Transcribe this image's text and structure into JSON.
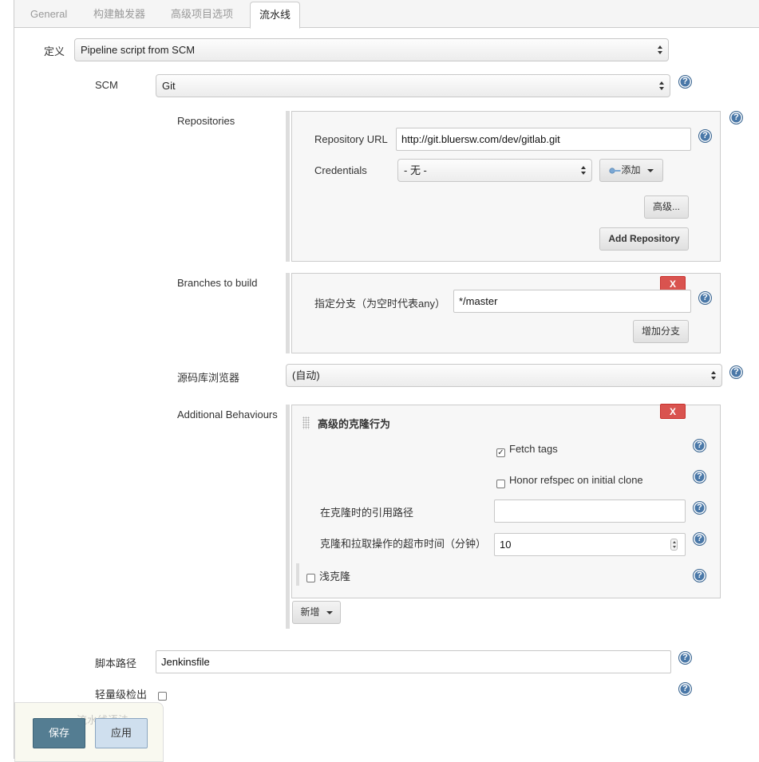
{
  "tabs": [
    "General",
    "构建触发器",
    "高级项目选项",
    "流水线"
  ],
  "definition": {
    "label": "定义",
    "value": "Pipeline script from SCM"
  },
  "scm": {
    "label": "SCM",
    "value": "Git"
  },
  "repositories": {
    "label": "Repositories",
    "url_label": "Repository URL",
    "url_value": "http://git.bluersw.com/dev/gitlab.git",
    "credentials_label": "Credentials",
    "credentials_value": "- 无 -",
    "add_label": "添加",
    "advanced_label": "高级...",
    "add_repo_label": "Add Repository"
  },
  "branches": {
    "label": "Branches to build",
    "delete_label": "X",
    "spec_label": "指定分支（为空时代表any）",
    "spec_value": "*/master",
    "add_branch_label": "增加分支"
  },
  "browser": {
    "label": "源码库浏览器",
    "value": "(自动)"
  },
  "behaviours": {
    "label": "Additional Behaviours",
    "delete_label": "X",
    "section_title": "高级的克隆行为",
    "fetch_tags_label": "Fetch tags",
    "fetch_tags_checked": true,
    "honor_refspec_label": "Honor refspec on initial clone",
    "honor_refspec_checked": false,
    "reference_label": "在克隆时的引用路径",
    "reference_value": "",
    "timeout_label": "克隆和拉取操作的超市时间（分钟）",
    "timeout_value": "10",
    "shallow_label": "浅克隆",
    "shallow_checked": false,
    "add_label": "新增"
  },
  "script_path": {
    "label": "脚本路径",
    "value": "Jenkinsfile"
  },
  "lightweight": {
    "label": "轻量级检出",
    "checked": false
  },
  "hidden_label": "流水线语法",
  "footer": {
    "save_label": "保存",
    "apply_label": "应用"
  },
  "icons": {
    "help": "help-icon",
    "key": "key-icon",
    "grip": "drag-handle-icon"
  },
  "colors": {
    "delete": "#d9534f",
    "help": "#4a78a8",
    "save": "#547d92",
    "apply": "#cfdfee"
  }
}
